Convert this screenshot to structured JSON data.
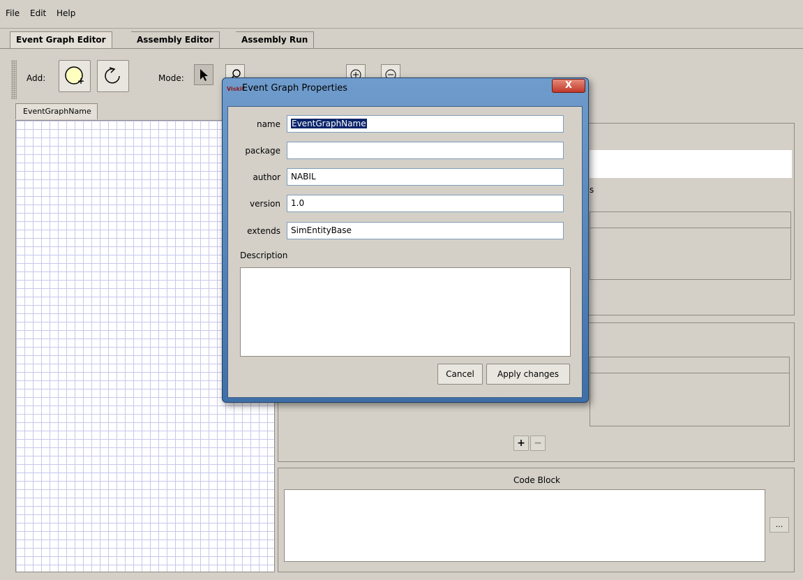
{
  "menu": {
    "items": [
      "File",
      "Edit",
      "Help"
    ]
  },
  "tabs": [
    "Event Graph Editor",
    "Assembly Editor",
    "Assembly Run"
  ],
  "toolbar": {
    "add_label": "Add:",
    "mode_label": "Mode:"
  },
  "graph_tab": {
    "label": "EventGraphName"
  },
  "right": {
    "partial_label_s": "s",
    "code_block_label": "Code Block",
    "ellipsis": "...",
    "plus": "+",
    "minus": "−"
  },
  "dialog": {
    "title": "Event Graph Properties",
    "logo": "Viskit",
    "close": "X",
    "fields": {
      "name_label": "name",
      "name_value": "EventGraphName",
      "package_label": "package",
      "package_value": "",
      "author_label": "author",
      "author_value": "NABIL",
      "version_label": "version",
      "version_value": "1.0",
      "extends_label": "extends",
      "extends_value": "SimEntityBase"
    },
    "description_label": "Description",
    "description_value": "",
    "cancel": "Cancel",
    "apply": "Apply changes"
  },
  "colors": {
    "selection": "#0a246a",
    "window_bg": "#d4d0c8",
    "grid": "#c7c7ee",
    "title_bar": "#6f9ccc"
  }
}
